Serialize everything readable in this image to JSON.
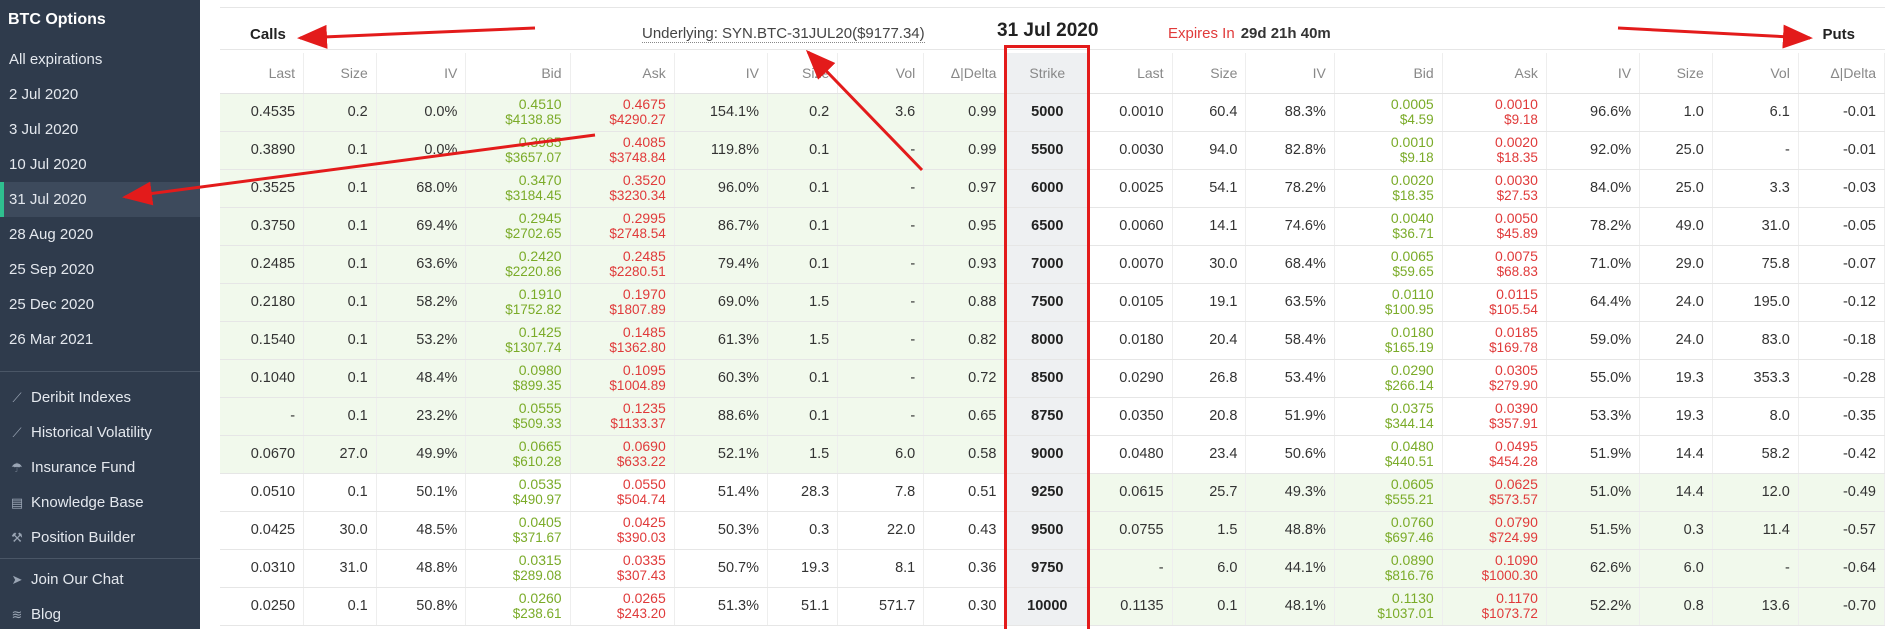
{
  "sidebar": {
    "brand": "BTC Options",
    "expirations": [
      "All expirations",
      "2 Jul 2020",
      "3 Jul 2020",
      "10 Jul 2020",
      "31 Jul 2020",
      "28 Aug 2020",
      "25 Sep 2020",
      "25 Dec 2020",
      "26 Mar 2021"
    ],
    "active_index": 4,
    "links": [
      {
        "label": "Deribit Indexes",
        "icon": "chart-line-icon"
      },
      {
        "label": "Historical Volatility",
        "icon": "chart-line-icon"
      },
      {
        "label": "Insurance Fund",
        "icon": "umbrella-icon"
      },
      {
        "label": "Knowledge Base",
        "icon": "book-icon"
      },
      {
        "label": "Position Builder",
        "icon": "hammer-icon"
      }
    ],
    "links2": [
      {
        "label": "Join Our Chat",
        "icon": "telegram-icon"
      },
      {
        "label": "Blog",
        "icon": "rss-icon"
      }
    ]
  },
  "header": {
    "calls": "Calls",
    "puts": "Puts",
    "underlying": "Underlying: SYN.BTC-31JUL20($9177.34)",
    "date": "31 Jul 2020",
    "expires_label": "Expires In",
    "expires_value": "29d 21h 40m"
  },
  "columns": {
    "calls": [
      "Last",
      "Size",
      "IV",
      "Bid",
      "Ask",
      "IV",
      "Size",
      "Vol",
      "Δ|Delta"
    ],
    "strike": "Strike",
    "puts": [
      "Last",
      "Size",
      "IV",
      "Bid",
      "Ask",
      "IV",
      "Size",
      "Vol",
      "Δ|Delta"
    ]
  },
  "colors": {
    "bid": "#7aab28",
    "ask": "#e03a3a",
    "itm": "#f1f9ec",
    "highlight": "#e31b1b",
    "sidebar": "#2f3b4c"
  },
  "rows": [
    {
      "strike": "5000",
      "itm": "call",
      "call": [
        "0.4535",
        "0.2",
        "0.0%",
        [
          "0.4510",
          "$4138.85"
        ],
        [
          "0.4675",
          "$4290.27"
        ],
        "154.1%",
        "0.2",
        "3.6",
        "0.99"
      ],
      "put": [
        "0.0010",
        "60.4",
        "88.3%",
        [
          "0.0005",
          "$4.59"
        ],
        [
          "0.0010",
          "$9.18"
        ],
        "96.6%",
        "1.0",
        "6.1",
        "-0.01"
      ]
    },
    {
      "strike": "5500",
      "itm": "call",
      "call": [
        "0.3890",
        "0.1",
        "0.0%",
        [
          "0.3985",
          "$3657.07"
        ],
        [
          "0.4085",
          "$3748.84"
        ],
        "119.8%",
        "0.1",
        "-",
        "0.99"
      ],
      "put": [
        "0.0030",
        "94.0",
        "82.8%",
        [
          "0.0010",
          "$9.18"
        ],
        [
          "0.0020",
          "$18.35"
        ],
        "92.0%",
        "25.0",
        "-",
        "-0.01"
      ]
    },
    {
      "strike": "6000",
      "itm": "call",
      "call": [
        "0.3525",
        "0.1",
        "68.0%",
        [
          "0.3470",
          "$3184.45"
        ],
        [
          "0.3520",
          "$3230.34"
        ],
        "96.0%",
        "0.1",
        "-",
        "0.97"
      ],
      "put": [
        "0.0025",
        "54.1",
        "78.2%",
        [
          "0.0020",
          "$18.35"
        ],
        [
          "0.0030",
          "$27.53"
        ],
        "84.0%",
        "25.0",
        "3.3",
        "-0.03"
      ]
    },
    {
      "strike": "6500",
      "itm": "call",
      "call": [
        "0.3750",
        "0.1",
        "69.4%",
        [
          "0.2945",
          "$2702.65"
        ],
        [
          "0.2995",
          "$2748.54"
        ],
        "86.7%",
        "0.1",
        "-",
        "0.95"
      ],
      "put": [
        "0.0060",
        "14.1",
        "74.6%",
        [
          "0.0040",
          "$36.71"
        ],
        [
          "0.0050",
          "$45.89"
        ],
        "78.2%",
        "49.0",
        "31.0",
        "-0.05"
      ]
    },
    {
      "strike": "7000",
      "itm": "call",
      "call": [
        "0.2485",
        "0.1",
        "63.6%",
        [
          "0.2420",
          "$2220.86"
        ],
        [
          "0.2485",
          "$2280.51"
        ],
        "79.4%",
        "0.1",
        "-",
        "0.93"
      ],
      "put": [
        "0.0070",
        "30.0",
        "68.4%",
        [
          "0.0065",
          "$59.65"
        ],
        [
          "0.0075",
          "$68.83"
        ],
        "71.0%",
        "29.0",
        "75.8",
        "-0.07"
      ]
    },
    {
      "strike": "7500",
      "itm": "call",
      "call": [
        "0.2180",
        "0.1",
        "58.2%",
        [
          "0.1910",
          "$1752.82"
        ],
        [
          "0.1970",
          "$1807.89"
        ],
        "69.0%",
        "1.5",
        "-",
        "0.88"
      ],
      "put": [
        "0.0105",
        "19.1",
        "63.5%",
        [
          "0.0110",
          "$100.95"
        ],
        [
          "0.0115",
          "$105.54"
        ],
        "64.4%",
        "24.0",
        "195.0",
        "-0.12"
      ]
    },
    {
      "strike": "8000",
      "itm": "call",
      "call": [
        "0.1540",
        "0.1",
        "53.2%",
        [
          "0.1425",
          "$1307.74"
        ],
        [
          "0.1485",
          "$1362.80"
        ],
        "61.3%",
        "1.5",
        "-",
        "0.82"
      ],
      "put": [
        "0.0180",
        "20.4",
        "58.4%",
        [
          "0.0180",
          "$165.19"
        ],
        [
          "0.0185",
          "$169.78"
        ],
        "59.0%",
        "24.0",
        "83.0",
        "-0.18"
      ]
    },
    {
      "strike": "8500",
      "itm": "call",
      "call": [
        "0.1040",
        "0.1",
        "48.4%",
        [
          "0.0980",
          "$899.35"
        ],
        [
          "0.1095",
          "$1004.89"
        ],
        "60.3%",
        "0.1",
        "-",
        "0.72"
      ],
      "put": [
        "0.0290",
        "26.8",
        "53.4%",
        [
          "0.0290",
          "$266.14"
        ],
        [
          "0.0305",
          "$279.90"
        ],
        "55.0%",
        "19.3",
        "353.3",
        "-0.28"
      ]
    },
    {
      "strike": "8750",
      "itm": "call",
      "call": [
        "-",
        "0.1",
        "23.2%",
        [
          "0.0555",
          "$509.33"
        ],
        [
          "0.1235",
          "$1133.37"
        ],
        "88.6%",
        "0.1",
        "-",
        "0.65"
      ],
      "put": [
        "0.0350",
        "20.8",
        "51.9%",
        [
          "0.0375",
          "$344.14"
        ],
        [
          "0.0390",
          "$357.91"
        ],
        "53.3%",
        "19.3",
        "8.0",
        "-0.35"
      ]
    },
    {
      "strike": "9000",
      "itm": "call",
      "call": [
        "0.0670",
        "27.0",
        "49.9%",
        [
          "0.0665",
          "$610.28"
        ],
        [
          "0.0690",
          "$633.22"
        ],
        "52.1%",
        "1.5",
        "6.0",
        "0.58"
      ],
      "put": [
        "0.0480",
        "23.4",
        "50.6%",
        [
          "0.0480",
          "$440.51"
        ],
        [
          "0.0495",
          "$454.28"
        ],
        "51.9%",
        "14.4",
        "58.2",
        "-0.42"
      ]
    },
    {
      "strike": "9250",
      "itm": "put",
      "call": [
        "0.0510",
        "0.1",
        "50.1%",
        [
          "0.0535",
          "$490.97"
        ],
        [
          "0.0550",
          "$504.74"
        ],
        "51.4%",
        "28.3",
        "7.8",
        "0.51"
      ],
      "put": [
        "0.0615",
        "25.7",
        "49.3%",
        [
          "0.0605",
          "$555.21"
        ],
        [
          "0.0625",
          "$573.57"
        ],
        "51.0%",
        "14.4",
        "12.0",
        "-0.49"
      ]
    },
    {
      "strike": "9500",
      "itm": "put",
      "call": [
        "0.0425",
        "30.0",
        "48.5%",
        [
          "0.0405",
          "$371.67"
        ],
        [
          "0.0425",
          "$390.03"
        ],
        "50.3%",
        "0.3",
        "22.0",
        "0.43"
      ],
      "put": [
        "0.0755",
        "1.5",
        "48.8%",
        [
          "0.0760",
          "$697.46"
        ],
        [
          "0.0790",
          "$724.99"
        ],
        "51.5%",
        "0.3",
        "11.4",
        "-0.57"
      ]
    },
    {
      "strike": "9750",
      "itm": "put",
      "call": [
        "0.0310",
        "31.0",
        "48.8%",
        [
          "0.0315",
          "$289.08"
        ],
        [
          "0.0335",
          "$307.43"
        ],
        "50.7%",
        "19.3",
        "8.1",
        "0.36"
      ],
      "put": [
        "-",
        "6.0",
        "44.1%",
        [
          "0.0890",
          "$816.76"
        ],
        [
          "0.1090",
          "$1000.30"
        ],
        "62.6%",
        "6.0",
        "-",
        "-0.64"
      ]
    },
    {
      "strike": "10000",
      "itm": "put",
      "call": [
        "0.0250",
        "0.1",
        "50.8%",
        [
          "0.0260",
          "$238.61"
        ],
        [
          "0.0265",
          "$243.20"
        ],
        "51.3%",
        "51.1",
        "571.7",
        "0.30"
      ],
      "put": [
        "0.1135",
        "0.1",
        "48.1%",
        [
          "0.1130",
          "$1037.01"
        ],
        [
          "0.1170",
          "$1073.72"
        ],
        "52.2%",
        "0.8",
        "13.6",
        "-0.70"
      ]
    }
  ]
}
